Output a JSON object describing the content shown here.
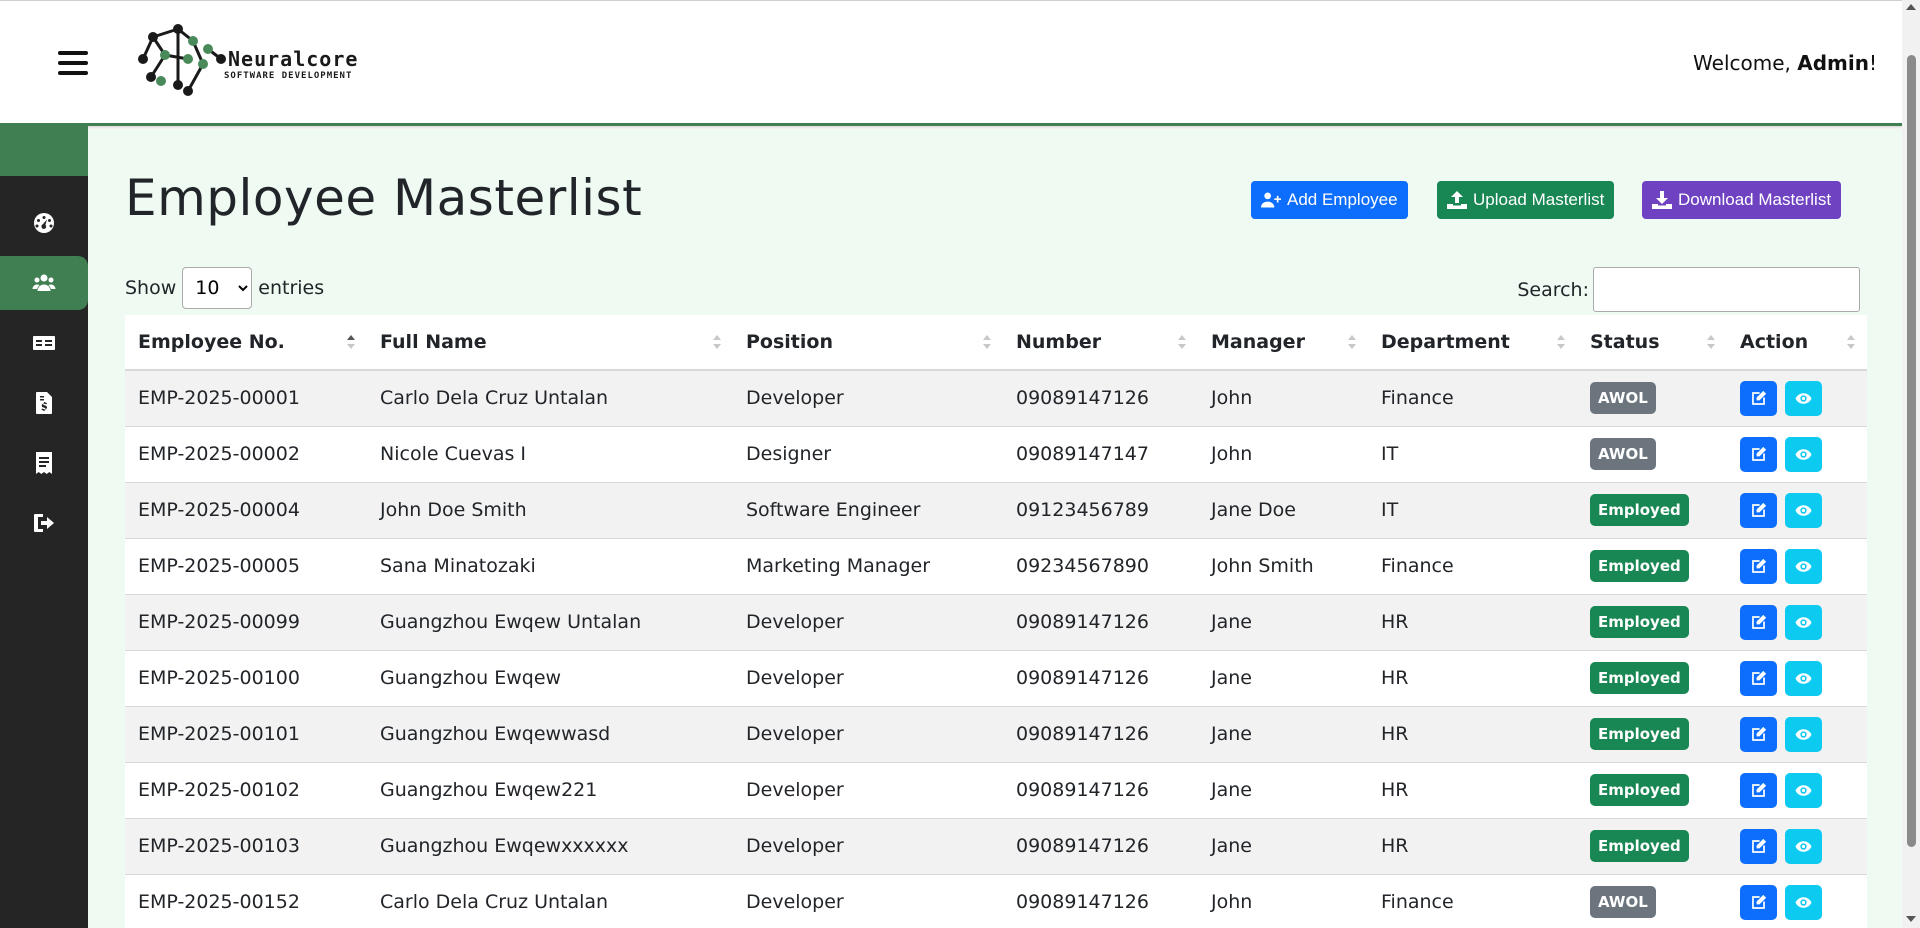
{
  "header": {
    "logo_title": "Neuralcore",
    "logo_subtitle": "SOFTWARE DEVELOPMENT",
    "welcome_prefix": "Welcome, ",
    "welcome_user": "Admin",
    "welcome_suffix": "!"
  },
  "sidebar": {
    "items": [
      {
        "icon": "dashboard-icon",
        "active": false
      },
      {
        "icon": "users-icon",
        "active": true
      },
      {
        "icon": "id-card-icon",
        "active": false
      },
      {
        "icon": "invoice-icon",
        "active": false
      },
      {
        "icon": "receipt-icon",
        "active": false
      },
      {
        "icon": "logout-icon",
        "active": false
      }
    ]
  },
  "main": {
    "title": "Employee Masterlist",
    "buttons": {
      "add": "Add Employee",
      "upload": "Upload Masterlist",
      "download": "Download Masterlist"
    },
    "show_label": "Show",
    "entries_value": "10",
    "entries_label": "entries",
    "search_label": "Search:",
    "search_value": ""
  },
  "colors": {
    "primary": "#0d6efd",
    "success": "#198754",
    "purple": "#6f42c1",
    "info": "#0dcaf0",
    "secondary": "#6c757d",
    "brand_green": "#3f7f52",
    "sidebar_bg": "#252525"
  },
  "table": {
    "columns": [
      "Employee No.",
      "Full Name",
      "Position",
      "Number",
      "Manager",
      "Department",
      "Status",
      "Action"
    ],
    "rows": [
      {
        "emp_no": "EMP-2025-00001",
        "name": "Carlo Dela Cruz Untalan",
        "position": "Developer",
        "number": "09089147126",
        "manager": "John",
        "department": "Finance",
        "status": "AWOL"
      },
      {
        "emp_no": "EMP-2025-00002",
        "name": "Nicole Cuevas I",
        "position": "Designer",
        "number": "09089147147",
        "manager": "John",
        "department": "IT",
        "status": "AWOL"
      },
      {
        "emp_no": "EMP-2025-00004",
        "name": "John Doe Smith",
        "position": "Software Engineer",
        "number": "09123456789",
        "manager": "Jane Doe",
        "department": "IT",
        "status": "Employed"
      },
      {
        "emp_no": "EMP-2025-00005",
        "name": "Sana Minatozaki",
        "position": "Marketing Manager",
        "number": "09234567890",
        "manager": "John Smith",
        "department": "Finance",
        "status": "Employed"
      },
      {
        "emp_no": "EMP-2025-00099",
        "name": "Guangzhou Ewqew Untalan",
        "position": "Developer",
        "number": "09089147126",
        "manager": "Jane",
        "department": "HR",
        "status": "Employed"
      },
      {
        "emp_no": "EMP-2025-00100",
        "name": "Guangzhou Ewqew",
        "position": "Developer",
        "number": "09089147126",
        "manager": "Jane",
        "department": "HR",
        "status": "Employed"
      },
      {
        "emp_no": "EMP-2025-00101",
        "name": "Guangzhou Ewqewwasd",
        "position": "Developer",
        "number": "09089147126",
        "manager": "Jane",
        "department": "HR",
        "status": "Employed"
      },
      {
        "emp_no": "EMP-2025-00102",
        "name": "Guangzhou Ewqew221",
        "position": "Developer",
        "number": "09089147126",
        "manager": "Jane",
        "department": "HR",
        "status": "Employed"
      },
      {
        "emp_no": "EMP-2025-00103",
        "name": "Guangzhou Ewqewxxxxxx",
        "position": "Developer",
        "number": "09089147126",
        "manager": "Jane",
        "department": "HR",
        "status": "Employed"
      },
      {
        "emp_no": "EMP-2025-00152",
        "name": "Carlo Dela Cruz Untalan",
        "position": "Developer",
        "number": "09089147126",
        "manager": "John",
        "department": "Finance",
        "status": "AWOL"
      }
    ]
  }
}
